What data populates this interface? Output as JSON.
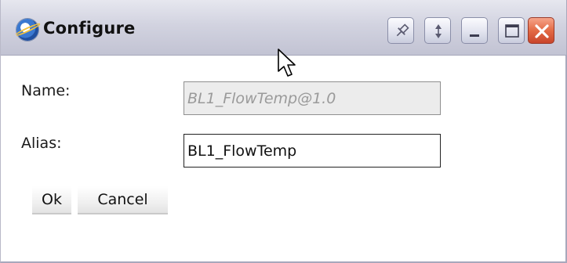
{
  "window": {
    "title": "Configure",
    "icon": "internet-explorer-icon"
  },
  "titlebar_buttons": [
    {
      "name": "pin-button",
      "icon": "pin-icon"
    },
    {
      "name": "restore-button",
      "icon": "arrows-icon"
    },
    {
      "name": "minimize-button",
      "icon": "minimize-icon"
    },
    {
      "name": "maximize-button",
      "icon": "maximize-icon"
    },
    {
      "name": "close-button",
      "icon": "close-icon"
    }
  ],
  "form": {
    "name_label": "Name:",
    "name_value": "BL1_FlowTemp@1.0",
    "alias_label": "Alias:",
    "alias_value": "BL1_FlowTemp"
  },
  "buttons": {
    "ok_label": "Ok",
    "cancel_label": "Cancel"
  },
  "colors": {
    "close_button": "#e36a45",
    "titlebar": "#d2d3e0",
    "disabled_field": "#ececec"
  }
}
